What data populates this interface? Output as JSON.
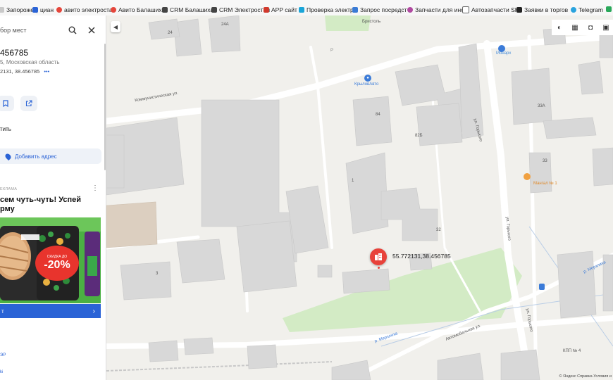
{
  "bookmarks": [
    {
      "label": "Запорожец",
      "color": "#c9c9c9"
    },
    {
      "label": "циан",
      "color": "#2a63d6"
    },
    {
      "label": "авито электроста",
      "color": "#e5463b"
    },
    {
      "label": "Авито Балашиха",
      "color": "#e5463b"
    },
    {
      "label": "CRM Балашиха",
      "color": "#444444"
    },
    {
      "label": "CRM Электростал",
      "color": "#444444"
    },
    {
      "label": "APP сайт",
      "color": "#d0392c"
    },
    {
      "label": "Проверка электр",
      "color": "#1aa5d8"
    },
    {
      "label": "Запрос посредст",
      "color": "#3a7bd5"
    },
    {
      "label": "Запчасти для ино",
      "color": "#b04aa0"
    },
    {
      "label": "Автозапчасти SK",
      "color": "#666666"
    },
    {
      "label": "Заявки в торгов",
      "color": "#222222"
    },
    {
      "label": "Telegram",
      "color": "#2aa3de"
    }
  ],
  "sidebar": {
    "search_text": "бор мест",
    "title": "456785",
    "region": "5, Московская область",
    "coords_small": "2131, 38.456785",
    "more": "•••",
    "share_label": "тить",
    "add_address": "Добавить адрес",
    "ad": {
      "label": "ЕКЛАМА",
      "title_line1": "сем чуть-чуть! Успей",
      "title_line2": "рму",
      "discount_small": "СКИДКА ДО",
      "discount": "-20%",
      "cta": "т"
    },
    "bottom_link1": "ЭР",
    "bottom_link2": "ki"
  },
  "map": {
    "pin_label": "55.772131,38.456785",
    "labels": {
      "street_kommun": "Коммунистическая ул.",
      "street_gorkogo1": "ул. Горького",
      "street_gorkogo2": "ул. Горького",
      "street_gorkogo3": "ул. Горького",
      "street_avtomob": "Автомобильная ул.",
      "river_mersha": "р. Мерзлиха",
      "river2": "р. Мерзлиха",
      "bristol": "Бристоль",
      "monarkh": "Монарх",
      "krylov": "КрыловАвто",
      "mangal": "Мангал № 1",
      "kpp": "КПП № 4",
      "b24": "24",
      "b24a": "24А",
      "b84": "84",
      "b82b": "82Б",
      "b1": "1",
      "b32": "32",
      "b3": "3",
      "b33a": "33А",
      "b33": "33",
      "parking": "P"
    },
    "copyright": "© Яндекс   Справка   Условия и"
  }
}
